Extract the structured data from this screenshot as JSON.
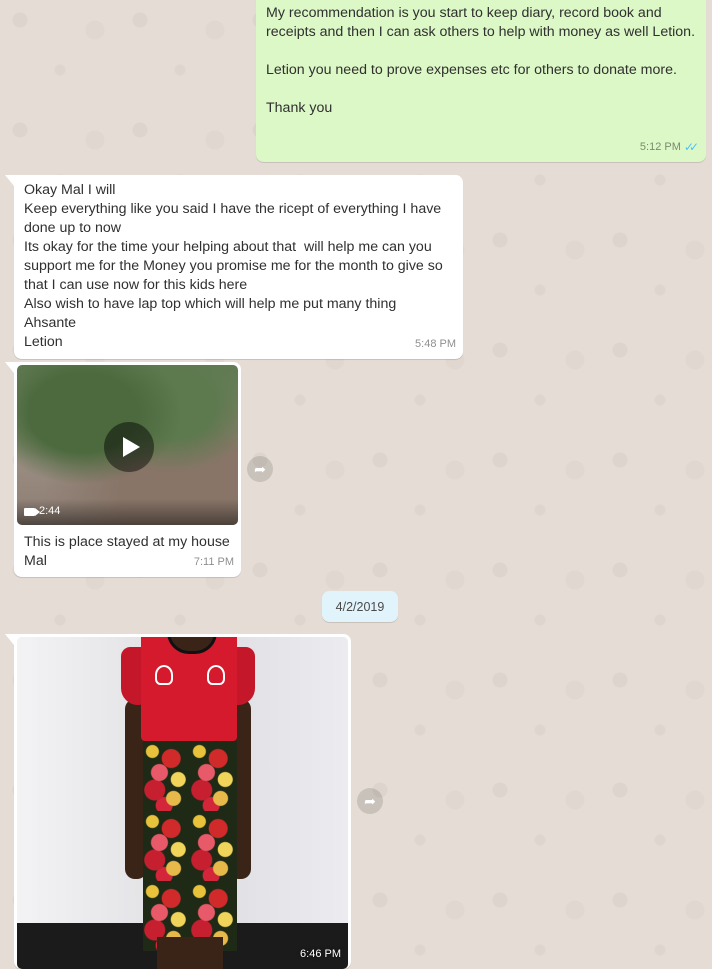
{
  "chat": {
    "messages": [
      {
        "direction": "outgoing",
        "paragraphs": [
          "My recommendation is you start to keep diary, record book and receipts and then I can ask others to help with money as well Letion.",
          "Letion you need to prove expenses etc for others to donate more.",
          "Thank you"
        ],
        "time": "5:12 PM",
        "status_icon": "double-check-read-icon"
      },
      {
        "direction": "incoming",
        "text": "Okay Mal I will\nKeep everything like you said I have the ricept of everything I have done up to now\nIts okay for the time your helping about that  will help me can you support me for the Money you promise me for the month to give so that I can use now for this kids here\nAlso wish to have lap top which will help me put many thing\nAhsante\nLetion",
        "time": "5:48 PM"
      },
      {
        "direction": "incoming",
        "type": "video",
        "duration": "2:44",
        "caption": "This is place stayed at my house Mal",
        "time": "7:11 PM"
      },
      {
        "direction": "incoming",
        "type": "image",
        "time": "6:46 PM"
      }
    ],
    "date_divider": "4/2/2019"
  },
  "colors": {
    "background": "#e5ddd5",
    "outgoing_bubble": "#dcf8c6",
    "incoming_bubble": "#ffffff",
    "read_ticks": "#4fc3f7",
    "date_chip": "#e1f3fb"
  }
}
